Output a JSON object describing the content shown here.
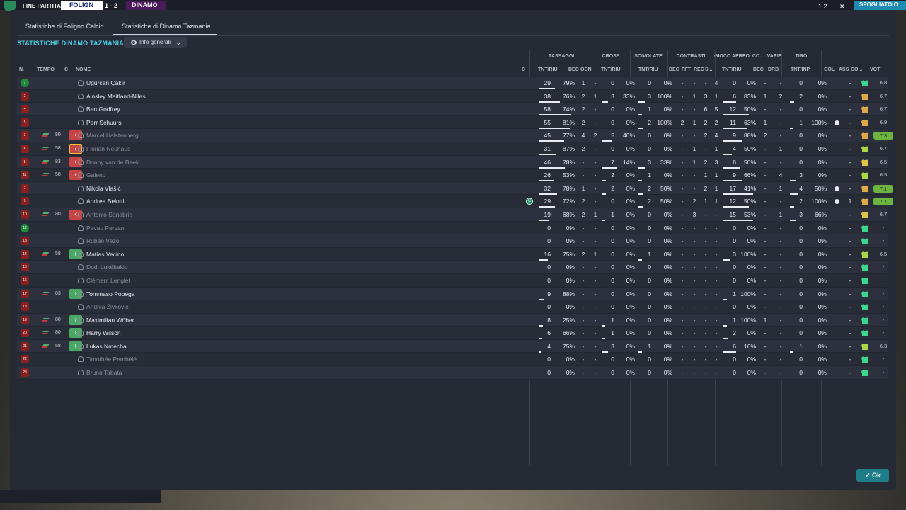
{
  "topbar": {
    "fine_label": "FINE PARTITA",
    "team_home": "FOLIGN",
    "team_away": "DINAMO",
    "score": "1 - 2",
    "right_num": "1 2",
    "close": "✕",
    "action": "SPOGLIATOIO"
  },
  "tabs": [
    {
      "label": "Statistiche di Foligno Calcio"
    },
    {
      "label": "Statistiche di Dinamo Tazmania"
    }
  ],
  "section_title": "STATISTICHE DINAMO TAZMANIA",
  "dropdown": {
    "label": "Info generali",
    "chevron": "⌄"
  },
  "groups": {
    "passaggi": "PASSAGGI",
    "cross": "CROSS",
    "scivolate": "SCIVOLATE",
    "contrasti": "CONTRASTI",
    "gioco_aereo": "GIOCO AEREO",
    "co": "CO...",
    "varie": "VARIE",
    "tiro": "TIRO"
  },
  "headers": {
    "n": "N.",
    "tempo": "TEMPO",
    "c": "C",
    "nome": "NOME",
    "c2": "C",
    "pas_tnt": "TNT/RIU",
    "dec": "DEC",
    "ocn": "OCN",
    "cross_tnt": "TNT/RIU",
    "sciv_tnt": "TNT/RIU",
    "dec2": "DEC",
    "fft": "FFT",
    "rec": "REC",
    "s": "S...",
    "aereo_tnt": "TNT/RIU",
    "dec3": "DEC",
    "drb": "DRB",
    "tiro_tnt": "TNT/INP",
    "gol": "GOL",
    "ass": "ASS",
    "co2": "CO...",
    "vot": "VOT"
  },
  "ok_label": "Ok",
  "players": [
    {
      "n": "1",
      "gk": true,
      "name": "Uğurcan Çakır",
      "dim": false,
      "sub": "",
      "mins": "",
      "pas": [
        "29",
        "79%"
      ],
      "dec": "1",
      "ocn": "-",
      "cross": [
        "0",
        "0%"
      ],
      "sciv": [
        "0",
        "0%"
      ],
      "cdec": "-",
      "fft": "-",
      "rec": "-",
      "s": "4",
      "aereo": [
        "0",
        "0%"
      ],
      "adec": "-",
      "drb": "-",
      "tiro": [
        "0",
        "0%"
      ],
      "gol": "",
      "ass": "-",
      "heart": "green",
      "vot": "6.8",
      "best": false,
      "capt": false
    },
    {
      "n": "2",
      "gk": false,
      "name": "Ainsley Maitland-Niles",
      "dim": false,
      "sub": "",
      "mins": "",
      "pas": [
        "38",
        "76%"
      ],
      "dec": "2",
      "ocn": "1",
      "cross": [
        "3",
        "33%"
      ],
      "sciv": [
        "3",
        "100%"
      ],
      "cdec": "-",
      "fft": "1",
      "rec": "3",
      "s": "1",
      "aereo": [
        "6",
        "83%"
      ],
      "adec": "1",
      "drb": "2",
      "tiro": [
        "2",
        "0%"
      ],
      "gol": "",
      "ass": "-",
      "heart": "amber",
      "vot": "6.7",
      "best": false,
      "capt": false
    },
    {
      "n": "4",
      "gk": false,
      "name": "Ben Godfrey",
      "dim": false,
      "sub": "",
      "mins": "",
      "pas": [
        "58",
        "74%"
      ],
      "dec": "2",
      "ocn": "-",
      "cross": [
        "0",
        "0%"
      ],
      "sciv": [
        "1",
        "0%"
      ],
      "cdec": "-",
      "fft": "-",
      "rec": "6",
      "s": "5",
      "aereo": [
        "12",
        "50%"
      ],
      "adec": "-",
      "drb": "-",
      "tiro": [
        "0",
        "0%"
      ],
      "gol": "",
      "ass": "-",
      "heart": "amber",
      "vot": "6.7",
      "best": false,
      "capt": false
    },
    {
      "n": "5",
      "gk": false,
      "name": "Perr Schuurs",
      "dim": false,
      "sub": "",
      "mins": "",
      "pas": [
        "55",
        "81%"
      ],
      "dec": "2",
      "ocn": "-",
      "cross": [
        "0",
        "0%"
      ],
      "sciv": [
        "2",
        "100%"
      ],
      "cdec": "2",
      "fft": "1",
      "rec": "2",
      "s": "2",
      "aereo": [
        "11",
        "63%"
      ],
      "adec": "1",
      "drb": "-",
      "tiro": [
        "1",
        "100%"
      ],
      "gol": "ball",
      "ass": "-",
      "heart": "amber",
      "vot": "6.9",
      "best": false,
      "capt": false
    },
    {
      "n": "3",
      "gk": false,
      "name": "Marcel Halstenberg",
      "dim": true,
      "sub": "out",
      "mins": "80",
      "pas": [
        "45",
        "77%"
      ],
      "dec": "4",
      "ocn": "2",
      "cross": [
        "5",
        "40%"
      ],
      "sciv": [
        "0",
        "0%"
      ],
      "cdec": "-",
      "fft": "-",
      "rec": "2",
      "s": "4",
      "aereo": [
        "9",
        "88%"
      ],
      "adec": "2",
      "drb": "-",
      "tiro": [
        "0",
        "0%"
      ],
      "gol": "",
      "ass": "-",
      "heart": "amber",
      "vot": "7.3",
      "best": true,
      "capt": false
    },
    {
      "n": "6",
      "gk": false,
      "name": "Florian Neuhaus",
      "dim": true,
      "sub": "out-hl",
      "mins": "58",
      "pas": [
        "31",
        "87%"
      ],
      "dec": "2",
      "ocn": "-",
      "cross": [
        "0",
        "0%"
      ],
      "sciv": [
        "0",
        "0%"
      ],
      "cdec": "-",
      "fft": "1",
      "rec": "-",
      "s": "1",
      "aereo": [
        "4",
        "50%"
      ],
      "adec": "-",
      "drb": "1",
      "tiro": [
        "0",
        "0%"
      ],
      "gol": "",
      "ass": "-",
      "heart": "lime",
      "vot": "6.7",
      "best": false,
      "capt": false
    },
    {
      "n": "8",
      "gk": false,
      "name": "Donny van de Beek",
      "dim": true,
      "sub": "out",
      "mins": "83",
      "pas": [
        "46",
        "78%"
      ],
      "dec": "-",
      "ocn": "-",
      "cross": [
        "7",
        "14%"
      ],
      "sciv": [
        "3",
        "33%"
      ],
      "cdec": "-",
      "fft": "1",
      "rec": "2",
      "s": "3",
      "aereo": [
        "8",
        "50%"
      ],
      "adec": "-",
      "drb": "-",
      "tiro": [
        "0",
        "0%"
      ],
      "gol": "",
      "ass": "-",
      "heart": "mix",
      "vot": "6.5",
      "best": false,
      "capt": false
    },
    {
      "n": "11",
      "gk": false,
      "name": "Galeno",
      "dim": true,
      "sub": "out",
      "mins": "58",
      "pas": [
        "26",
        "53%"
      ],
      "dec": "-",
      "ocn": "-",
      "cross": [
        "2",
        "0%"
      ],
      "sciv": [
        "1",
        "0%"
      ],
      "cdec": "-",
      "fft": "-",
      "rec": "1",
      "s": "1",
      "aereo": [
        "9",
        "66%"
      ],
      "adec": "-",
      "drb": "4",
      "tiro": [
        "3",
        "0%"
      ],
      "gol": "",
      "ass": "-",
      "heart": "lime",
      "vot": "6.5",
      "best": false,
      "capt": false
    },
    {
      "n": "7",
      "gk": false,
      "name": "Nikola Vlašić",
      "dim": false,
      "sub": "",
      "mins": "",
      "pas": [
        "32",
        "78%"
      ],
      "dec": "1",
      "ocn": "-",
      "cross": [
        "2",
        "0%"
      ],
      "sciv": [
        "2",
        "50%"
      ],
      "cdec": "-",
      "fft": "-",
      "rec": "2",
      "s": "1",
      "aereo": [
        "17",
        "41%"
      ],
      "adec": "-",
      "drb": "1",
      "tiro": [
        "4",
        "50%"
      ],
      "gol": "ball",
      "ass": "-",
      "heart": "amber",
      "vot": "7.1",
      "best": true,
      "capt": false
    },
    {
      "n": "9",
      "gk": false,
      "name": "Andrea Belotti",
      "dim": false,
      "sub": "",
      "mins": "",
      "pas": [
        "29",
        "72%"
      ],
      "dec": "2",
      "ocn": "-",
      "cross": [
        "0",
        "0%"
      ],
      "sciv": [
        "2",
        "50%"
      ],
      "cdec": "-",
      "fft": "2",
      "rec": "1",
      "s": "1",
      "aereo": [
        "12",
        "50%"
      ],
      "adec": "-",
      "drb": "-",
      "tiro": [
        "2",
        "100%"
      ],
      "gol": "ball",
      "ass": "1",
      "heart": "amber",
      "vot": "7.7",
      "best": true,
      "capt": true
    },
    {
      "n": "10",
      "gk": false,
      "name": "Antonio Sanabria",
      "dim": true,
      "sub": "out",
      "mins": "80",
      "pas": [
        "19",
        "68%"
      ],
      "dec": "2",
      "ocn": "1",
      "cross": [
        "1",
        "0%"
      ],
      "sciv": [
        "0",
        "0%"
      ],
      "cdec": "-",
      "fft": "3",
      "rec": "-",
      "s": "-",
      "aereo": [
        "15",
        "53%"
      ],
      "adec": "-",
      "drb": "1",
      "tiro": [
        "3",
        "66%"
      ],
      "gol": "",
      "ass": "-",
      "heart": "mix",
      "vot": "6.7",
      "best": false,
      "capt": false
    },
    {
      "n": "12",
      "gk": true,
      "name": "Pavao Pervan",
      "dim": true,
      "sub": "",
      "mins": "",
      "pas": [
        "0",
        "0%"
      ],
      "dec": "-",
      "ocn": "-",
      "cross": [
        "0",
        "0%"
      ],
      "sciv": [
        "0",
        "0%"
      ],
      "cdec": "-",
      "fft": "-",
      "rec": "-",
      "s": "-",
      "aereo": [
        "0",
        "0%"
      ],
      "adec": "-",
      "drb": "-",
      "tiro": [
        "0",
        "0%"
      ],
      "gol": "",
      "ass": "-",
      "heart": "green",
      "vot": "-",
      "best": false,
      "capt": false
    },
    {
      "n": "13",
      "gk": false,
      "name": "Rúben Vezo",
      "dim": true,
      "sub": "",
      "mins": "",
      "pas": [
        "0",
        "0%"
      ],
      "dec": "-",
      "ocn": "-",
      "cross": [
        "0",
        "0%"
      ],
      "sciv": [
        "0",
        "0%"
      ],
      "cdec": "-",
      "fft": "-",
      "rec": "-",
      "s": "-",
      "aereo": [
        "0",
        "0%"
      ],
      "adec": "-",
      "drb": "-",
      "tiro": [
        "0",
        "0%"
      ],
      "gol": "",
      "ass": "-",
      "heart": "green",
      "vot": "-",
      "best": false,
      "capt": false
    },
    {
      "n": "14",
      "gk": false,
      "name": "Matías Vecino",
      "dim": false,
      "sub": "in",
      "mins": "58",
      "pas": [
        "16",
        "75%"
      ],
      "dec": "2",
      "ocn": "1",
      "cross": [
        "0",
        "0%"
      ],
      "sciv": [
        "1",
        "0%"
      ],
      "cdec": "-",
      "fft": "-",
      "rec": "-",
      "s": "-",
      "aereo": [
        "3",
        "100%"
      ],
      "adec": "-",
      "drb": "-",
      "tiro": [
        "0",
        "0%"
      ],
      "gol": "",
      "ass": "-",
      "heart": "lime",
      "vot": "6.5",
      "best": false,
      "capt": false
    },
    {
      "n": "15",
      "gk": false,
      "name": "Dodi Lukébakio",
      "dim": true,
      "sub": "",
      "mins": "",
      "pas": [
        "0",
        "0%"
      ],
      "dec": "-",
      "ocn": "-",
      "cross": [
        "0",
        "0%"
      ],
      "sciv": [
        "0",
        "0%"
      ],
      "cdec": "-",
      "fft": "-",
      "rec": "-",
      "s": "-",
      "aereo": [
        "0",
        "0%"
      ],
      "adec": "-",
      "drb": "-",
      "tiro": [
        "0",
        "0%"
      ],
      "gol": "",
      "ass": "-",
      "heart": "green",
      "vot": "-",
      "best": false,
      "capt": false
    },
    {
      "n": "16",
      "gk": false,
      "name": "Clément Lenglet",
      "dim": true,
      "sub": "",
      "mins": "",
      "pas": [
        "0",
        "0%"
      ],
      "dec": "-",
      "ocn": "-",
      "cross": [
        "0",
        "0%"
      ],
      "sciv": [
        "0",
        "0%"
      ],
      "cdec": "-",
      "fft": "-",
      "rec": "-",
      "s": "-",
      "aereo": [
        "0",
        "0%"
      ],
      "adec": "-",
      "drb": "-",
      "tiro": [
        "0",
        "0%"
      ],
      "gol": "",
      "ass": "-",
      "heart": "green",
      "vot": "-",
      "best": false,
      "capt": false
    },
    {
      "n": "17",
      "gk": false,
      "name": "Tommaso Pobega",
      "dim": false,
      "sub": "in",
      "mins": "83",
      "pas": [
        "9",
        "88%"
      ],
      "dec": "-",
      "ocn": "-",
      "cross": [
        "0",
        "0%"
      ],
      "sciv": [
        "0",
        "0%"
      ],
      "cdec": "-",
      "fft": "-",
      "rec": "-",
      "s": "-",
      "aereo": [
        "1",
        "100%"
      ],
      "adec": "-",
      "drb": "-",
      "tiro": [
        "0",
        "0%"
      ],
      "gol": "",
      "ass": "-",
      "heart": "green",
      "vot": "-",
      "best": false,
      "capt": false
    },
    {
      "n": "18",
      "gk": false,
      "name": "Andrija Živković",
      "dim": true,
      "sub": "",
      "mins": "",
      "pas": [
        "0",
        "0%"
      ],
      "dec": "-",
      "ocn": "-",
      "cross": [
        "0",
        "0%"
      ],
      "sciv": [
        "0",
        "0%"
      ],
      "cdec": "-",
      "fft": "-",
      "rec": "-",
      "s": "-",
      "aereo": [
        "0",
        "0%"
      ],
      "adec": "-",
      "drb": "-",
      "tiro": [
        "0",
        "0%"
      ],
      "gol": "",
      "ass": "-",
      "heart": "green",
      "vot": "-",
      "best": false,
      "capt": false
    },
    {
      "n": "19",
      "gk": false,
      "name": "Maximilian Wöber",
      "dim": false,
      "sub": "in",
      "mins": "80",
      "pas": [
        "8",
        "25%"
      ],
      "dec": "-",
      "ocn": "-",
      "cross": [
        "1",
        "0%"
      ],
      "sciv": [
        "0",
        "0%"
      ],
      "cdec": "-",
      "fft": "-",
      "rec": "-",
      "s": "-",
      "aereo": [
        "1",
        "100%"
      ],
      "adec": "1",
      "drb": "-",
      "tiro": [
        "0",
        "0%"
      ],
      "gol": "",
      "ass": "-",
      "heart": "green",
      "vot": "-",
      "best": false,
      "capt": false
    },
    {
      "n": "20",
      "gk": false,
      "name": "Harry Wilson",
      "dim": false,
      "sub": "in",
      "mins": "80",
      "pas": [
        "6",
        "66%"
      ],
      "dec": "-",
      "ocn": "-",
      "cross": [
        "1",
        "0%"
      ],
      "sciv": [
        "0",
        "0%"
      ],
      "cdec": "-",
      "fft": "-",
      "rec": "-",
      "s": "-",
      "aereo": [
        "2",
        "0%"
      ],
      "adec": "-",
      "drb": "-",
      "tiro": [
        "0",
        "0%"
      ],
      "gol": "",
      "ass": "-",
      "heart": "green",
      "vot": "-",
      "best": false,
      "capt": false
    },
    {
      "n": "21",
      "gk": false,
      "name": "Lukas Nmecha",
      "dim": false,
      "sub": "in",
      "mins": "58",
      "pas": [
        "4",
        "75%"
      ],
      "dec": "-",
      "ocn": "-",
      "cross": [
        "3",
        "0%"
      ],
      "sciv": [
        "1",
        "0%"
      ],
      "cdec": "-",
      "fft": "-",
      "rec": "-",
      "s": "-",
      "aereo": [
        "6",
        "16%"
      ],
      "adec": "-",
      "drb": "-",
      "tiro": [
        "1",
        "0%"
      ],
      "gol": "",
      "ass": "-",
      "heart": "lime",
      "vot": "6.3",
      "best": false,
      "capt": false
    },
    {
      "n": "22",
      "gk": false,
      "name": "Timothée Pembélé",
      "dim": true,
      "sub": "",
      "mins": "",
      "pas": [
        "0",
        "0%"
      ],
      "dec": "-",
      "ocn": "-",
      "cross": [
        "0",
        "0%"
      ],
      "sciv": [
        "0",
        "0%"
      ],
      "cdec": "-",
      "fft": "-",
      "rec": "-",
      "s": "-",
      "aereo": [
        "0",
        "0%"
      ],
      "adec": "-",
      "drb": "-",
      "tiro": [
        "0",
        "0%"
      ],
      "gol": "",
      "ass": "-",
      "heart": "green",
      "vot": "-",
      "best": false,
      "capt": false
    },
    {
      "n": "23",
      "gk": false,
      "name": "Bruno Tabata",
      "dim": true,
      "sub": "",
      "mins": "",
      "pas": [
        "0",
        "0%"
      ],
      "dec": "-",
      "ocn": "-",
      "cross": [
        "0",
        "0%"
      ],
      "sciv": [
        "0",
        "0%"
      ],
      "cdec": "-",
      "fft": "-",
      "rec": "-",
      "s": "-",
      "aereo": [
        "0",
        "0%"
      ],
      "adec": "-",
      "drb": "-",
      "tiro": [
        "0",
        "0%"
      ],
      "gol": "",
      "ass": "-",
      "heart": "green",
      "vot": "-",
      "best": false,
      "capt": false
    }
  ]
}
